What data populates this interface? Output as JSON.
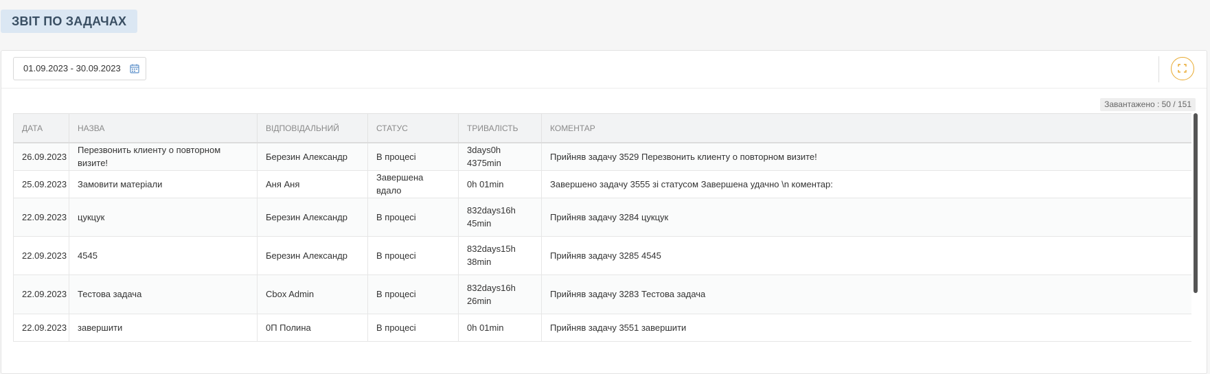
{
  "page": {
    "title": "ЗВІТ ПО ЗАДАЧАХ"
  },
  "filter": {
    "date_range": "01.09.2023 - 30.09.2023",
    "calendar_icon": "calendar-icon",
    "fullscreen_icon": "fullscreen-icon",
    "accent_color": "#e8a92e"
  },
  "loaded": {
    "text": "Завантажено : 50 / 151"
  },
  "table": {
    "headers": {
      "date": "Дата",
      "name": "Назва",
      "responsible": "Відповідальний",
      "status": "Статус",
      "duration": "Тривалість",
      "comment": "Коментар"
    },
    "rows": [
      {
        "date": "26.09.2023",
        "name": "Перезвонить клиенту о повторном визите!",
        "responsible": "Березин Александр",
        "status": "В процесі",
        "duration": "3days0h 4375min",
        "comment": "Прийняв задачу 3529 Перезвонить клиенту о повторном визите!"
      },
      {
        "date": "25.09.2023",
        "name": "Замовити матеріали",
        "responsible": "Аня Аня",
        "status": "Завершена вдало",
        "duration": "0h 01min",
        "comment": "Завершено задачу  3555 зі статусом Завершена удачно \\n коментар:"
      },
      {
        "date": "22.09.2023",
        "name": "цукцук",
        "responsible": "Березин Александр",
        "status": "В процесі",
        "duration": "832days16h 45min",
        "comment": "Прийняв задачу 3284 цукцук"
      },
      {
        "date": "22.09.2023",
        "name": "4545",
        "responsible": "Березин Александр",
        "status": "В процесі",
        "duration": "832days15h 38min",
        "comment": "Прийняв задачу 3285 4545"
      },
      {
        "date": "22.09.2023",
        "name": "Тестова задача",
        "responsible": "Cbox Admin",
        "status": "В процесі",
        "duration": "832days16h 26min",
        "comment": "Прийняв задачу 3283 Тестова задача"
      },
      {
        "date": "22.09.2023",
        "name": "завершити",
        "responsible": "0П Полина",
        "status": "В процесі",
        "duration": "0h 01min",
        "comment": "Прийняв задачу 3551 завершити"
      }
    ]
  }
}
